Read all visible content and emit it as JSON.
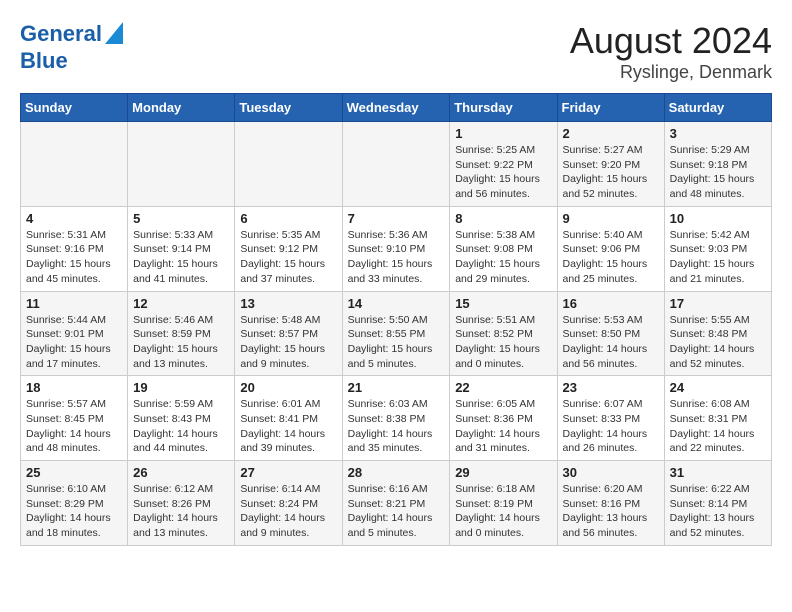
{
  "logo": {
    "line1": "General",
    "line2": "Blue"
  },
  "title": "August 2024",
  "subtitle": "Ryslinge, Denmark",
  "days_header": [
    "Sunday",
    "Monday",
    "Tuesday",
    "Wednesday",
    "Thursday",
    "Friday",
    "Saturday"
  ],
  "weeks": [
    [
      {
        "num": "",
        "info": ""
      },
      {
        "num": "",
        "info": ""
      },
      {
        "num": "",
        "info": ""
      },
      {
        "num": "",
        "info": ""
      },
      {
        "num": "1",
        "info": "Sunrise: 5:25 AM\nSunset: 9:22 PM\nDaylight: 15 hours\nand 56 minutes."
      },
      {
        "num": "2",
        "info": "Sunrise: 5:27 AM\nSunset: 9:20 PM\nDaylight: 15 hours\nand 52 minutes."
      },
      {
        "num": "3",
        "info": "Sunrise: 5:29 AM\nSunset: 9:18 PM\nDaylight: 15 hours\nand 48 minutes."
      }
    ],
    [
      {
        "num": "4",
        "info": "Sunrise: 5:31 AM\nSunset: 9:16 PM\nDaylight: 15 hours\nand 45 minutes."
      },
      {
        "num": "5",
        "info": "Sunrise: 5:33 AM\nSunset: 9:14 PM\nDaylight: 15 hours\nand 41 minutes."
      },
      {
        "num": "6",
        "info": "Sunrise: 5:35 AM\nSunset: 9:12 PM\nDaylight: 15 hours\nand 37 minutes."
      },
      {
        "num": "7",
        "info": "Sunrise: 5:36 AM\nSunset: 9:10 PM\nDaylight: 15 hours\nand 33 minutes."
      },
      {
        "num": "8",
        "info": "Sunrise: 5:38 AM\nSunset: 9:08 PM\nDaylight: 15 hours\nand 29 minutes."
      },
      {
        "num": "9",
        "info": "Sunrise: 5:40 AM\nSunset: 9:06 PM\nDaylight: 15 hours\nand 25 minutes."
      },
      {
        "num": "10",
        "info": "Sunrise: 5:42 AM\nSunset: 9:03 PM\nDaylight: 15 hours\nand 21 minutes."
      }
    ],
    [
      {
        "num": "11",
        "info": "Sunrise: 5:44 AM\nSunset: 9:01 PM\nDaylight: 15 hours\nand 17 minutes."
      },
      {
        "num": "12",
        "info": "Sunrise: 5:46 AM\nSunset: 8:59 PM\nDaylight: 15 hours\nand 13 minutes."
      },
      {
        "num": "13",
        "info": "Sunrise: 5:48 AM\nSunset: 8:57 PM\nDaylight: 15 hours\nand 9 minutes."
      },
      {
        "num": "14",
        "info": "Sunrise: 5:50 AM\nSunset: 8:55 PM\nDaylight: 15 hours\nand 5 minutes."
      },
      {
        "num": "15",
        "info": "Sunrise: 5:51 AM\nSunset: 8:52 PM\nDaylight: 15 hours\nand 0 minutes."
      },
      {
        "num": "16",
        "info": "Sunrise: 5:53 AM\nSunset: 8:50 PM\nDaylight: 14 hours\nand 56 minutes."
      },
      {
        "num": "17",
        "info": "Sunrise: 5:55 AM\nSunset: 8:48 PM\nDaylight: 14 hours\nand 52 minutes."
      }
    ],
    [
      {
        "num": "18",
        "info": "Sunrise: 5:57 AM\nSunset: 8:45 PM\nDaylight: 14 hours\nand 48 minutes."
      },
      {
        "num": "19",
        "info": "Sunrise: 5:59 AM\nSunset: 8:43 PM\nDaylight: 14 hours\nand 44 minutes."
      },
      {
        "num": "20",
        "info": "Sunrise: 6:01 AM\nSunset: 8:41 PM\nDaylight: 14 hours\nand 39 minutes."
      },
      {
        "num": "21",
        "info": "Sunrise: 6:03 AM\nSunset: 8:38 PM\nDaylight: 14 hours\nand 35 minutes."
      },
      {
        "num": "22",
        "info": "Sunrise: 6:05 AM\nSunset: 8:36 PM\nDaylight: 14 hours\nand 31 minutes."
      },
      {
        "num": "23",
        "info": "Sunrise: 6:07 AM\nSunset: 8:33 PM\nDaylight: 14 hours\nand 26 minutes."
      },
      {
        "num": "24",
        "info": "Sunrise: 6:08 AM\nSunset: 8:31 PM\nDaylight: 14 hours\nand 22 minutes."
      }
    ],
    [
      {
        "num": "25",
        "info": "Sunrise: 6:10 AM\nSunset: 8:29 PM\nDaylight: 14 hours\nand 18 minutes."
      },
      {
        "num": "26",
        "info": "Sunrise: 6:12 AM\nSunset: 8:26 PM\nDaylight: 14 hours\nand 13 minutes."
      },
      {
        "num": "27",
        "info": "Sunrise: 6:14 AM\nSunset: 8:24 PM\nDaylight: 14 hours\nand 9 minutes."
      },
      {
        "num": "28",
        "info": "Sunrise: 6:16 AM\nSunset: 8:21 PM\nDaylight: 14 hours\nand 5 minutes."
      },
      {
        "num": "29",
        "info": "Sunrise: 6:18 AM\nSunset: 8:19 PM\nDaylight: 14 hours\nand 0 minutes."
      },
      {
        "num": "30",
        "info": "Sunrise: 6:20 AM\nSunset: 8:16 PM\nDaylight: 13 hours\nand 56 minutes."
      },
      {
        "num": "31",
        "info": "Sunrise: 6:22 AM\nSunset: 8:14 PM\nDaylight: 13 hours\nand 52 minutes."
      }
    ]
  ]
}
